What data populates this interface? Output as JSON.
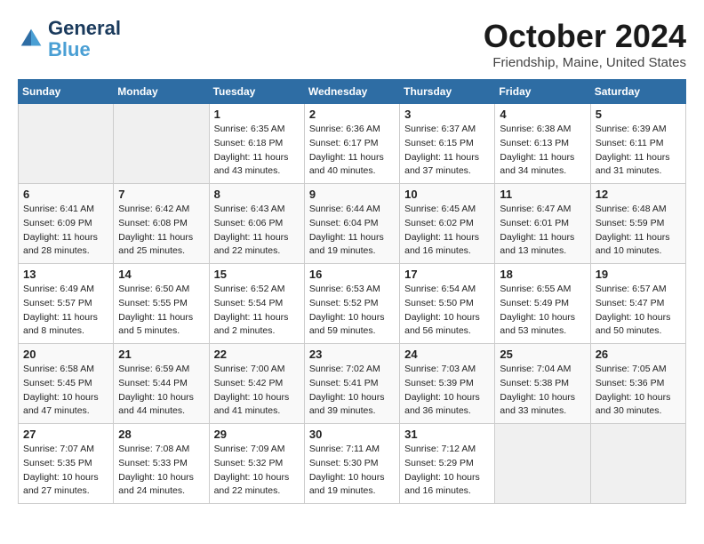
{
  "header": {
    "logo_line1": "General",
    "logo_line2": "Blue",
    "month": "October 2024",
    "location": "Friendship, Maine, United States"
  },
  "days_of_week": [
    "Sunday",
    "Monday",
    "Tuesday",
    "Wednesday",
    "Thursday",
    "Friday",
    "Saturday"
  ],
  "weeks": [
    [
      {
        "day": "",
        "info": ""
      },
      {
        "day": "",
        "info": ""
      },
      {
        "day": "1",
        "info": "Sunrise: 6:35 AM\nSunset: 6:18 PM\nDaylight: 11 hours\nand 43 minutes."
      },
      {
        "day": "2",
        "info": "Sunrise: 6:36 AM\nSunset: 6:17 PM\nDaylight: 11 hours\nand 40 minutes."
      },
      {
        "day": "3",
        "info": "Sunrise: 6:37 AM\nSunset: 6:15 PM\nDaylight: 11 hours\nand 37 minutes."
      },
      {
        "day": "4",
        "info": "Sunrise: 6:38 AM\nSunset: 6:13 PM\nDaylight: 11 hours\nand 34 minutes."
      },
      {
        "day": "5",
        "info": "Sunrise: 6:39 AM\nSunset: 6:11 PM\nDaylight: 11 hours\nand 31 minutes."
      }
    ],
    [
      {
        "day": "6",
        "info": "Sunrise: 6:41 AM\nSunset: 6:09 PM\nDaylight: 11 hours\nand 28 minutes."
      },
      {
        "day": "7",
        "info": "Sunrise: 6:42 AM\nSunset: 6:08 PM\nDaylight: 11 hours\nand 25 minutes."
      },
      {
        "day": "8",
        "info": "Sunrise: 6:43 AM\nSunset: 6:06 PM\nDaylight: 11 hours\nand 22 minutes."
      },
      {
        "day": "9",
        "info": "Sunrise: 6:44 AM\nSunset: 6:04 PM\nDaylight: 11 hours\nand 19 minutes."
      },
      {
        "day": "10",
        "info": "Sunrise: 6:45 AM\nSunset: 6:02 PM\nDaylight: 11 hours\nand 16 minutes."
      },
      {
        "day": "11",
        "info": "Sunrise: 6:47 AM\nSunset: 6:01 PM\nDaylight: 11 hours\nand 13 minutes."
      },
      {
        "day": "12",
        "info": "Sunrise: 6:48 AM\nSunset: 5:59 PM\nDaylight: 11 hours\nand 10 minutes."
      }
    ],
    [
      {
        "day": "13",
        "info": "Sunrise: 6:49 AM\nSunset: 5:57 PM\nDaylight: 11 hours\nand 8 minutes."
      },
      {
        "day": "14",
        "info": "Sunrise: 6:50 AM\nSunset: 5:55 PM\nDaylight: 11 hours\nand 5 minutes."
      },
      {
        "day": "15",
        "info": "Sunrise: 6:52 AM\nSunset: 5:54 PM\nDaylight: 11 hours\nand 2 minutes."
      },
      {
        "day": "16",
        "info": "Sunrise: 6:53 AM\nSunset: 5:52 PM\nDaylight: 10 hours\nand 59 minutes."
      },
      {
        "day": "17",
        "info": "Sunrise: 6:54 AM\nSunset: 5:50 PM\nDaylight: 10 hours\nand 56 minutes."
      },
      {
        "day": "18",
        "info": "Sunrise: 6:55 AM\nSunset: 5:49 PM\nDaylight: 10 hours\nand 53 minutes."
      },
      {
        "day": "19",
        "info": "Sunrise: 6:57 AM\nSunset: 5:47 PM\nDaylight: 10 hours\nand 50 minutes."
      }
    ],
    [
      {
        "day": "20",
        "info": "Sunrise: 6:58 AM\nSunset: 5:45 PM\nDaylight: 10 hours\nand 47 minutes."
      },
      {
        "day": "21",
        "info": "Sunrise: 6:59 AM\nSunset: 5:44 PM\nDaylight: 10 hours\nand 44 minutes."
      },
      {
        "day": "22",
        "info": "Sunrise: 7:00 AM\nSunset: 5:42 PM\nDaylight: 10 hours\nand 41 minutes."
      },
      {
        "day": "23",
        "info": "Sunrise: 7:02 AM\nSunset: 5:41 PM\nDaylight: 10 hours\nand 39 minutes."
      },
      {
        "day": "24",
        "info": "Sunrise: 7:03 AM\nSunset: 5:39 PM\nDaylight: 10 hours\nand 36 minutes."
      },
      {
        "day": "25",
        "info": "Sunrise: 7:04 AM\nSunset: 5:38 PM\nDaylight: 10 hours\nand 33 minutes."
      },
      {
        "day": "26",
        "info": "Sunrise: 7:05 AM\nSunset: 5:36 PM\nDaylight: 10 hours\nand 30 minutes."
      }
    ],
    [
      {
        "day": "27",
        "info": "Sunrise: 7:07 AM\nSunset: 5:35 PM\nDaylight: 10 hours\nand 27 minutes."
      },
      {
        "day": "28",
        "info": "Sunrise: 7:08 AM\nSunset: 5:33 PM\nDaylight: 10 hours\nand 24 minutes."
      },
      {
        "day": "29",
        "info": "Sunrise: 7:09 AM\nSunset: 5:32 PM\nDaylight: 10 hours\nand 22 minutes."
      },
      {
        "day": "30",
        "info": "Sunrise: 7:11 AM\nSunset: 5:30 PM\nDaylight: 10 hours\nand 19 minutes."
      },
      {
        "day": "31",
        "info": "Sunrise: 7:12 AM\nSunset: 5:29 PM\nDaylight: 10 hours\nand 16 minutes."
      },
      {
        "day": "",
        "info": ""
      },
      {
        "day": "",
        "info": ""
      }
    ]
  ]
}
